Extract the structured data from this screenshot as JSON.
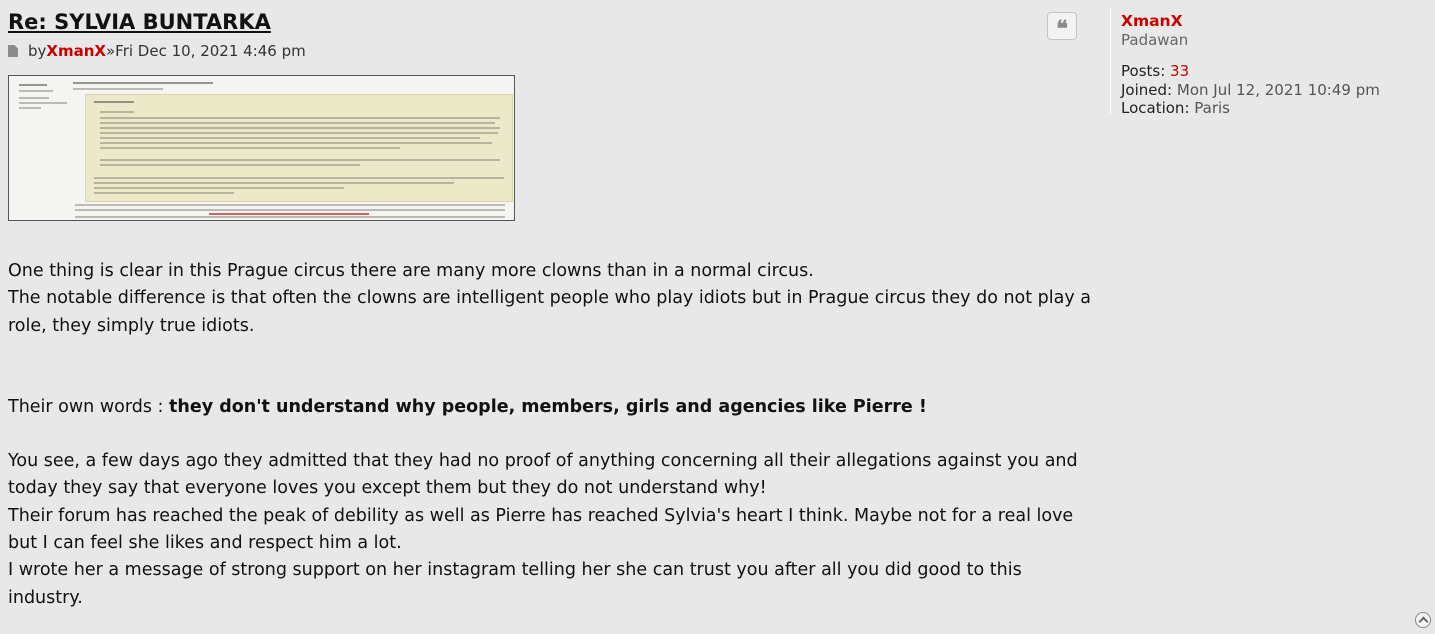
{
  "post": {
    "title": "Re: SYLVIA BUNTARKA",
    "by_label": "by",
    "author": "XmanX",
    "separator": "»",
    "date": "Fri Dec 10, 2021 4:46 pm",
    "icons": {
      "post_icon": "post-file-icon",
      "quote_icon": "quote-icon",
      "top_icon": "chevron-up-icon"
    },
    "paragraphs": {
      "p1": "One thing is clear in this Prague circus there are many more clowns than in a normal circus.",
      "p2": "The notable difference is that often the clowns are intelligent people who play idiots but in Prague circus they do not play a role, they simply true idiots.",
      "p3_prefix": "Their own words : ",
      "p3_bold": "they don't understand why people, members, girls and agencies like Pierre !",
      "p4": "You see, a few days ago they admitted that they had no proof of anything concerning all their allegations against you and today they say that everyone loves you except them but they do not understand why!",
      "p5": "Their forum has reached the peak of debility as well as Pierre has reached Sylvia's heart I think. Maybe not for a real love but I can feel she likes and respect him a lot.",
      "p6": "I wrote her a message of strong support on her instagram telling her she can trust you after all you did good to this industry."
    }
  },
  "profile": {
    "name": "XmanX",
    "rank": "Padawan",
    "posts_label": "Posts:",
    "posts_value": "33",
    "joined_label": "Joined:",
    "joined_value": "Mon Jul 12, 2021 10:49 pm",
    "location_label": "Location:",
    "location_value": "Paris"
  },
  "colors": {
    "background": "#e8e8e8",
    "author_red": "#cc0000",
    "text": "#111111"
  }
}
